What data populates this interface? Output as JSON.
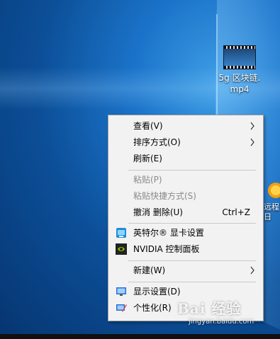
{
  "desktop": {
    "video_icon": {
      "label": "5g  区块链.\nmp4",
      "icon": "video-file-icon"
    },
    "remote_icon": {
      "label": "远程\n日",
      "icon": "sun-icon"
    }
  },
  "context_menu": {
    "items": [
      {
        "label": "查看(V)",
        "submenu": true
      },
      {
        "label": "排序方式(O)",
        "submenu": true
      },
      {
        "label": "刷新(E)"
      },
      {
        "label": "粘贴(P)",
        "disabled": true
      },
      {
        "label": "粘贴快捷方式(S)",
        "disabled": true
      },
      {
        "label": "撤消 删除(U)",
        "shortcut": "Ctrl+Z"
      },
      {
        "label": "英特尔® 显卡设置",
        "icon": "intel-graphics-icon"
      },
      {
        "label": "NVIDIA 控制面板",
        "icon": "nvidia-icon"
      },
      {
        "label": "新建(W)",
        "submenu": true
      },
      {
        "label": "显示设置(D)",
        "icon": "display-settings-icon"
      },
      {
        "label": "个性化(R)",
        "icon": "personalize-icon"
      }
    ]
  },
  "watermark": {
    "top": "Bai 经验",
    "bottom": "jingyan.baidu.com"
  },
  "colors": {
    "menu_bg": "#f2f2f2",
    "disabled_text": "#8a8a8a",
    "desktop_accent": "#1b73c9"
  }
}
